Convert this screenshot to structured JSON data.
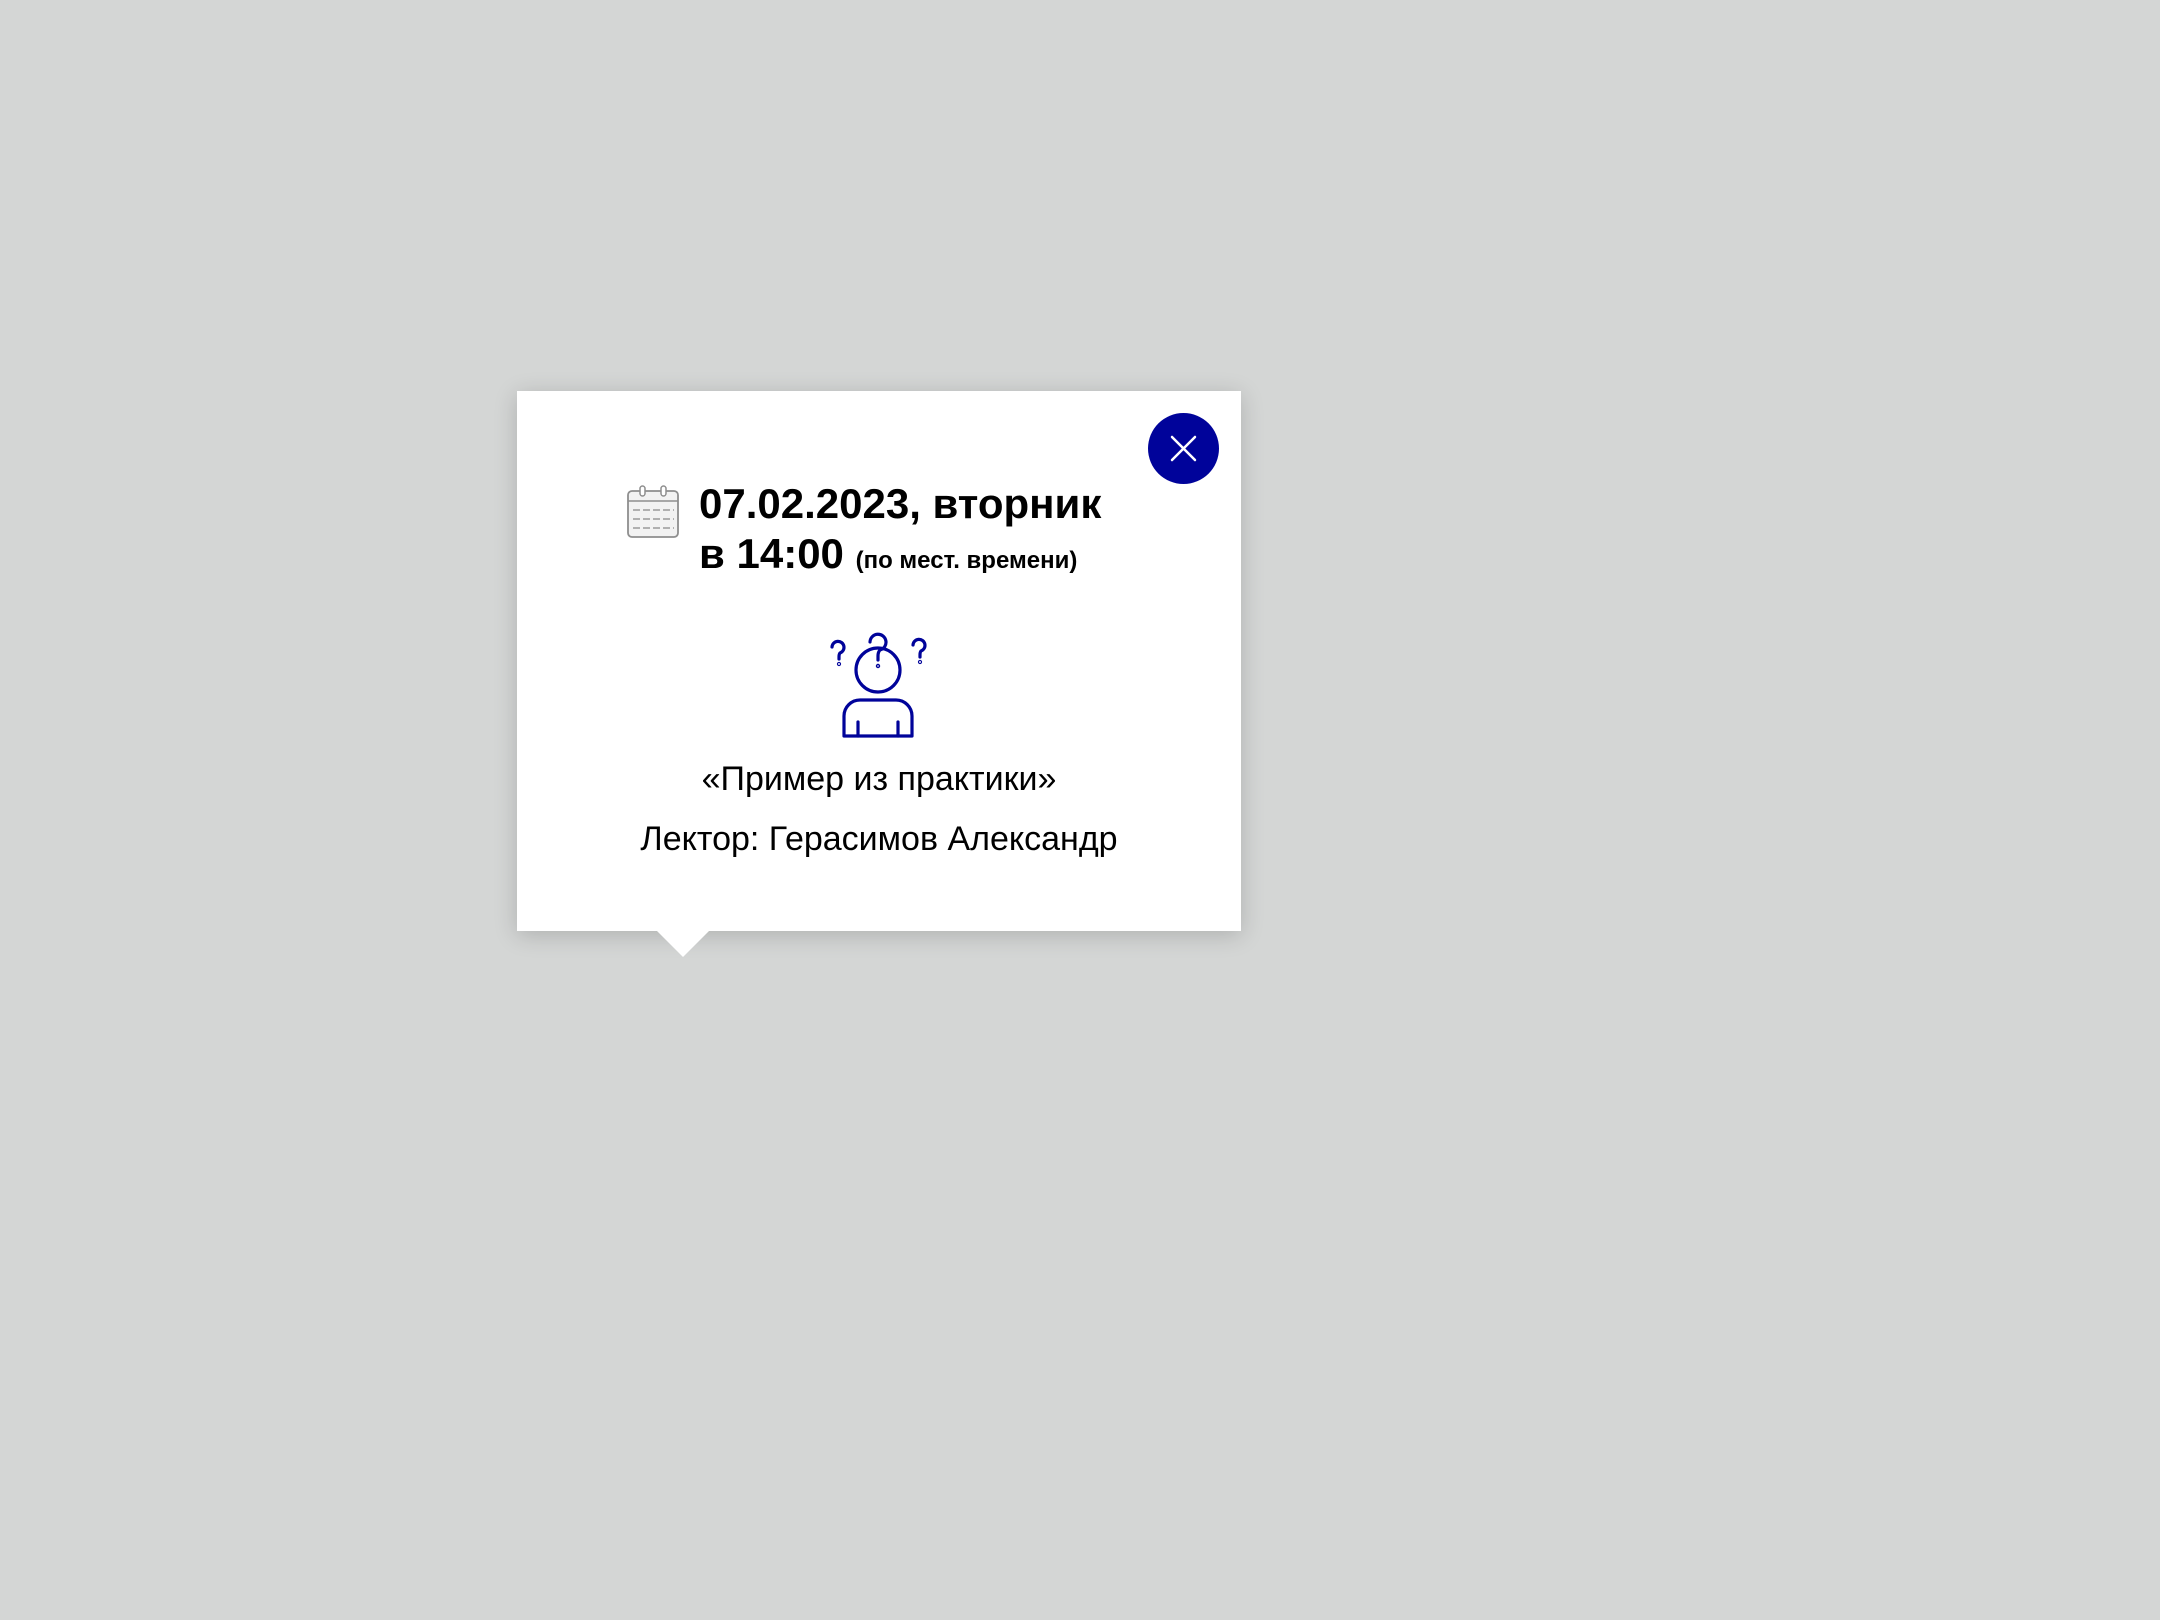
{
  "popup": {
    "date_text": "07.02.2023, вторник",
    "time_prefix": "в 14:00",
    "time_note": "(по мест. времени)",
    "lecture_title": "«Пример из практики»",
    "lecturer": "Лектор: Герасимов Александр",
    "icons": {
      "close": "close-icon",
      "calendar": "calendar-icon",
      "person": "confused-person-icon"
    }
  },
  "colors": {
    "accent": "#00039a",
    "background": "#d4d6d5",
    "card": "#ffffff"
  }
}
